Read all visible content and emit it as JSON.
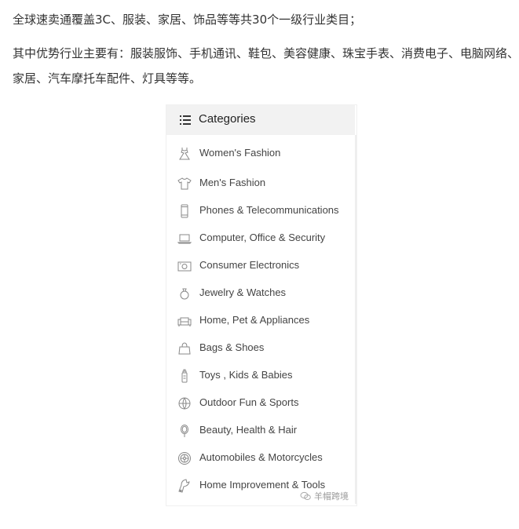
{
  "paragraphs": {
    "line1": "全球速卖通覆盖3C、服装、家居、饰品等等共30个一级行业类目；",
    "line2": "其中优势行业主要有：服装服饰、手机通讯、鞋包、美容健康、珠宝手表、消费电子、电脑网络、家居、汽车摩托车配件、灯具等等。"
  },
  "categories_panel": {
    "title": "Categories",
    "header_icon": "list-menu-icon",
    "items": [
      {
        "label": "Women's Fashion",
        "icon": "dress-icon"
      },
      {
        "label": "Men's Fashion",
        "icon": "tshirt-icon"
      },
      {
        "label": "Phones & Telecommunications",
        "icon": "phone-icon"
      },
      {
        "label": "Computer, Office & Security",
        "icon": "laptop-icon"
      },
      {
        "label": "Consumer Electronics",
        "icon": "camera-icon"
      },
      {
        "label": "Jewelry & Watches",
        "icon": "ring-icon"
      },
      {
        "label": "Home, Pet & Appliances",
        "icon": "sofa-icon"
      },
      {
        "label": "Bags & Shoes",
        "icon": "bag-icon"
      },
      {
        "label": "Toys , Kids & Babies",
        "icon": "baby-bottle-icon"
      },
      {
        "label": "Outdoor Fun & Sports",
        "icon": "ball-icon"
      },
      {
        "label": "Beauty, Health & Hair",
        "icon": "mirror-icon"
      },
      {
        "label": "Automobiles & Motorcycles",
        "icon": "wheel-icon"
      },
      {
        "label": "Home Improvement & Tools",
        "icon": "tool-icon"
      }
    ]
  },
  "watermark": {
    "text": "羊帽跨境",
    "icon": "wechat-icon"
  }
}
